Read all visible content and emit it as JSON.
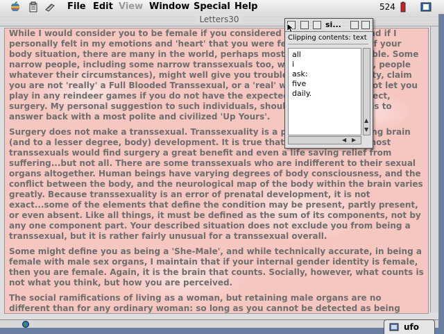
{
  "menubar": {
    "items": [
      {
        "label": "File",
        "enabled": true
      },
      {
        "label": "Edit",
        "enabled": true
      },
      {
        "label": "View",
        "enabled": false
      },
      {
        "label": "Window",
        "enabled": true
      },
      {
        "label": "Special",
        "enabled": true
      },
      {
        "label": "Help",
        "enabled": true
      }
    ],
    "clock": "524",
    "icons": [
      "apple-icon",
      "clipboard-icon",
      "scanner-icon",
      "battery-icon",
      "app-menu-icon"
    ]
  },
  "document": {
    "title": "Letters30",
    "paragraphs": [
      "While I would consider you to be female if you considered yourself female, and if I personally felt in my emotions and 'heart' that you were female, regardless of your body situation, there are many in the world, perhaps most, who are not capable. Some narrow people, including some narrow transsexuals too, who are not capable, people whatever their circumstances), might well give you trouble about your identity, claim you are not 'really' a Full Blooded Transsexual, or a 'real' woman. They may not let you play in any reindeer games if you do not have the expected operations, in effect, surgery. My personal suggestion to such individuals, should you meet them, is to answer back with a most polite and civilized 'Up Yours'.",
      "Surgery does not make a transsexual. Transsexuality is a problem of a differing brain (and to a lesser degree, body) development. It is true that overwhelmingly, most transsexuals would find surgery a great benefit and even a life saving relief from suffering...but not all. There are some transsexuals who are indifferent to their sexual organs altogether. Human beings have varying degrees of body consciousness, and the conflict between the body, and the neurological map of the body within the brain varies greatly. Because transsexuality is an error of prenatal development, it is not exact...some of the elements that define the condition may be present, partly present, or even absent. Like all things, it must be defined as the sum of its components, not by any one component part. Your described situation does not exclude you from being a transsexual, but it is rather fairly unusual for a transsexual overall.",
      "Some might define you as being a 'She-Male', and while technically accurate, in being a female with male sex organs, I maintain that if your internal gender identity is female, then you are female. Again, it is the brain that counts. Socially, however, what counts is not what you think, but how you are perceived.",
      "The social ramifications of living as a woman, but retaining male organs are no different than for any ordinary woman: so long as you cannot be detected as being unusual. One"
    ]
  },
  "clipping": {
    "title": "si...",
    "header": "Clipping contents: text",
    "lines": [
      "all",
      "i",
      "ask:",
      "five",
      "daily."
    ]
  },
  "taskbar": {
    "app_name": "ufo"
  },
  "colors": {
    "page_bg": "#f6c6c0",
    "text": "#6e6e6e",
    "desktop": "#6b7fa0"
  }
}
